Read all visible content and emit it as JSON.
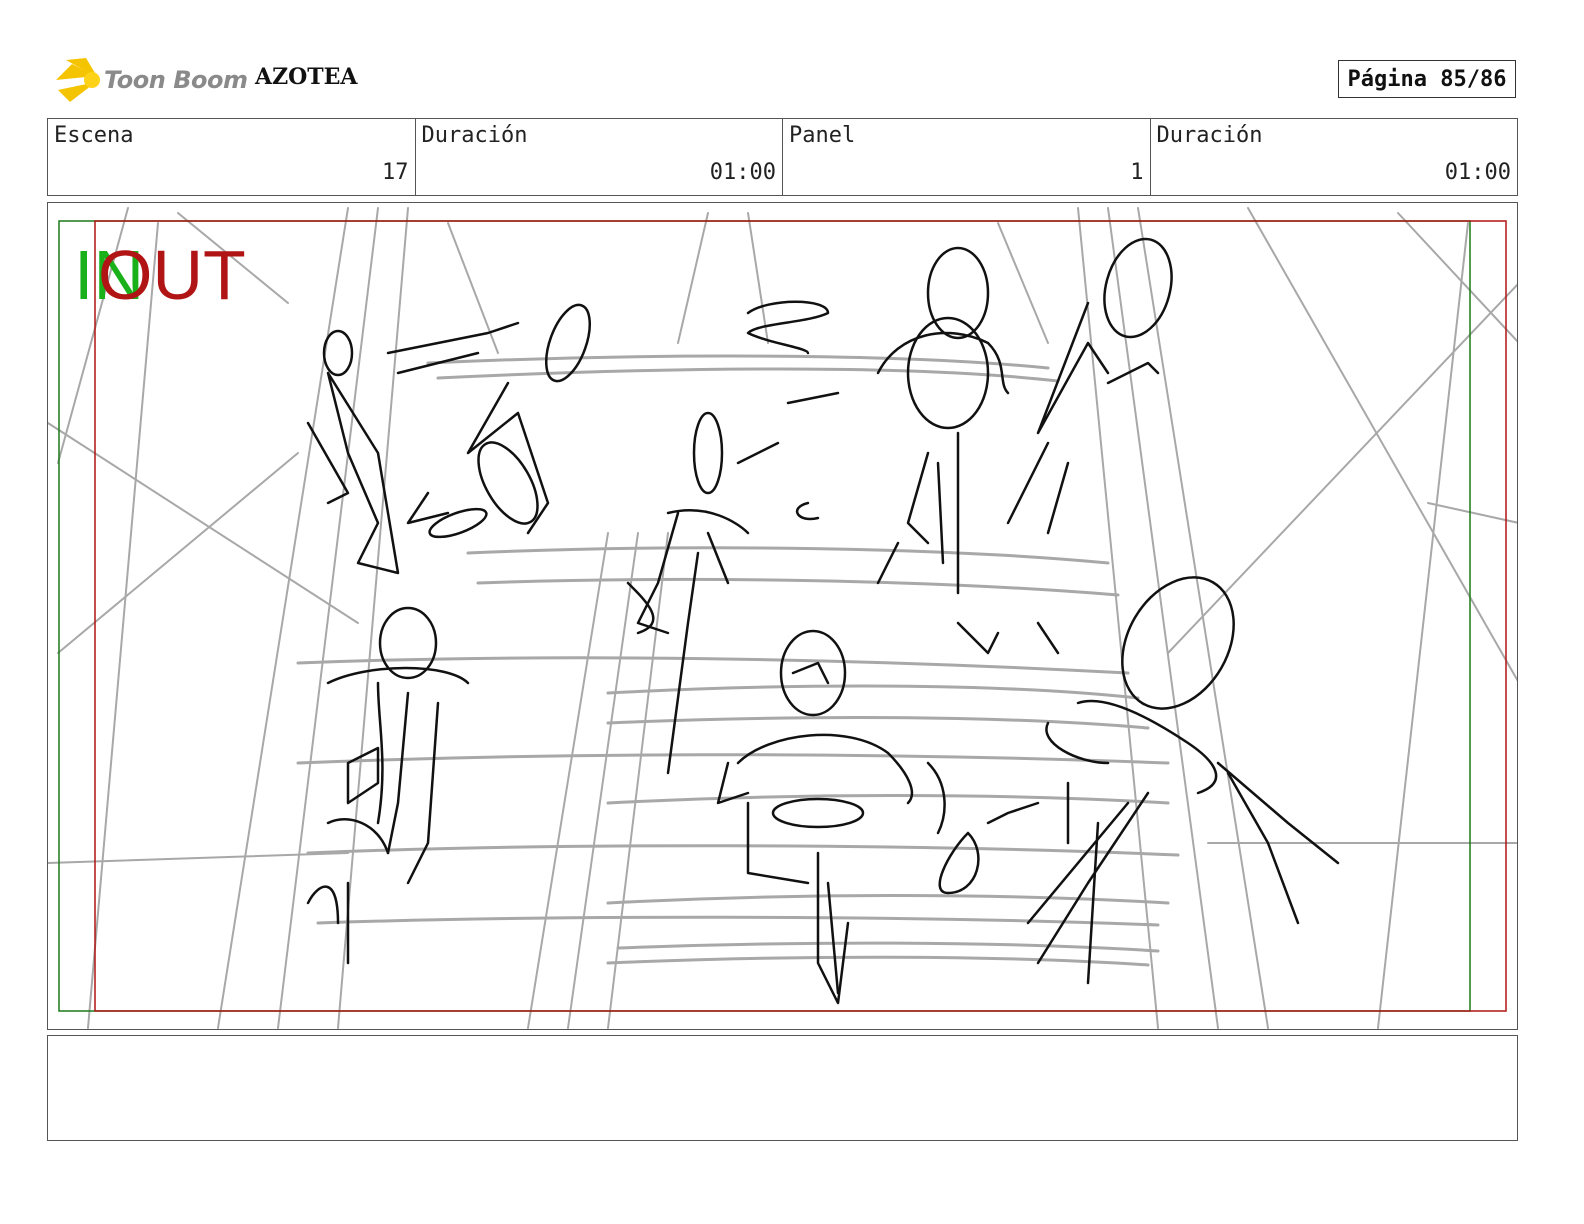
{
  "header": {
    "logo_text": "Toon Boom",
    "project_title": "AZOTEA",
    "page_label": "Página 85/86"
  },
  "info": {
    "scene_label": "Escena",
    "scene_value": "17",
    "scene_duration_label": "Duración",
    "scene_duration_value": "01:00",
    "panel_label": "Panel",
    "panel_value": "1",
    "panel_duration_label": "Duración",
    "panel_duration_value": "01:00"
  },
  "panel": {
    "in_label": "IN",
    "out_label": "OUT"
  },
  "notes": {
    "text": ""
  },
  "colors": {
    "in_frame": "#1a7a1a",
    "out_frame": "#b01414",
    "sketch_gray": "#a8a8a8",
    "sketch_black": "#111111",
    "logo_yellow": "#f5c400"
  }
}
